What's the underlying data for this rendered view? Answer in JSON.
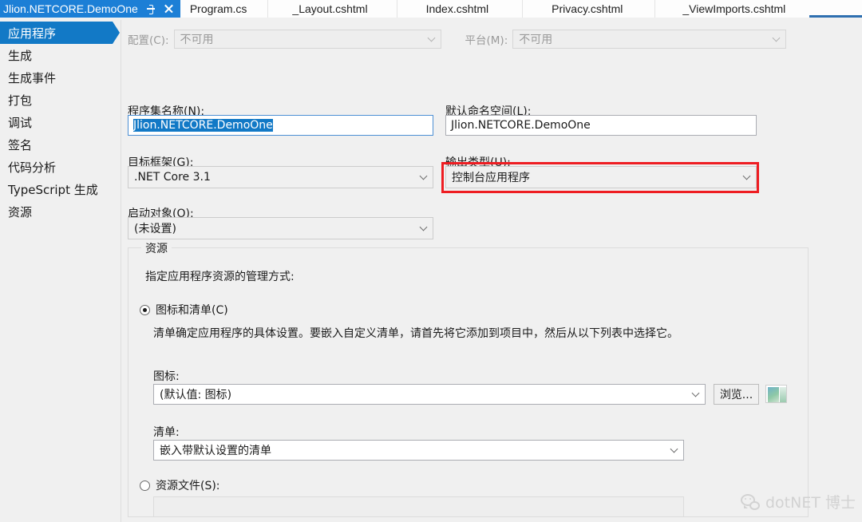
{
  "window": {
    "tabs": [
      {
        "label": "Jlion.NETCORE.DemoOne",
        "active": true
      },
      {
        "label": "Program.cs",
        "active": false
      },
      {
        "label": "_Layout.cshtml",
        "active": false
      },
      {
        "label": "Index.cshtml",
        "active": false
      },
      {
        "label": "Privacy.cshtml",
        "active": false
      },
      {
        "label": "_ViewImports.cshtml",
        "active": false
      }
    ]
  },
  "sidebar": {
    "items": [
      {
        "label": "应用程序",
        "selected": true
      },
      {
        "label": "生成",
        "selected": false
      },
      {
        "label": "生成事件",
        "selected": false
      },
      {
        "label": "打包",
        "selected": false
      },
      {
        "label": "调试",
        "selected": false
      },
      {
        "label": "签名",
        "selected": false
      },
      {
        "label": "代码分析",
        "selected": false
      },
      {
        "label": "TypeScript 生成",
        "selected": false
      },
      {
        "label": "资源",
        "selected": false
      }
    ]
  },
  "toolbar": {
    "configuration_label": "配置(C):",
    "configuration_value": "不可用",
    "platform_label": "平台(M):",
    "platform_value": "不可用"
  },
  "form": {
    "assembly_name_label": "程序集名称(N):",
    "assembly_name_value": "Jlion.NETCORE.DemoOne",
    "default_namespace_label": "默认命名空间(L):",
    "default_namespace_value": "Jlion.NETCORE.DemoOne",
    "target_framework_label": "目标框架(G):",
    "target_framework_value": ".NET Core 3.1",
    "output_type_label": "输出类型(U):",
    "output_type_value": "控制台应用程序",
    "startup_object_label": "启动对象(O):",
    "startup_object_value": "(未设置)"
  },
  "resources": {
    "group_title": "资源",
    "description": "指定应用程序资源的管理方式:",
    "icon_manifest_radio_label": "图标和清单(C)",
    "icon_manifest_radio_checked": true,
    "manifest_help_text": "清单确定应用程序的具体设置。要嵌入自定义清单，请首先将它添加到项目中，然后从以下列表中选择它。",
    "icon_label": "图标:",
    "icon_value": "(默认值: 图标)",
    "browse_button_label": "浏览...",
    "icon_preview_colors": [
      "#6fb2c8",
      "#8fc9a6",
      "#cfe3d2"
    ],
    "manifest_label": "清单:",
    "manifest_value": "嵌入带默认设置的清单",
    "resource_file_radio_label": "资源文件(S):",
    "resource_file_radio_checked": false,
    "resource_file_value": ""
  },
  "annotation": {
    "highlight_color": "#ee1d22",
    "highlight_target": "output_type_combobox"
  },
  "watermark": {
    "text": "dotNET 博士",
    "icon": "wechat-icon",
    "color": "#d2d2d2"
  }
}
